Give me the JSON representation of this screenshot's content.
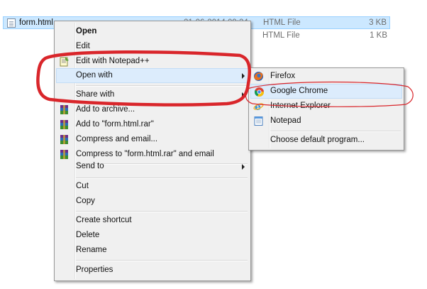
{
  "files": [
    {
      "name": "form.html",
      "date": "21-06-2014 09:24",
      "type": "HTML File",
      "size": "3 KB"
    },
    {
      "name": "",
      "date": "",
      "type": "HTML File",
      "size": "1 KB"
    }
  ],
  "context_menu": {
    "open": "Open",
    "edit": "Edit",
    "edit_notepadpp": "Edit with Notepad++",
    "open_with": "Open with",
    "share_with": "Share with",
    "add_to_archive": "Add to archive...",
    "add_to_rar": "Add to \"form.html.rar\"",
    "compress_email": "Compress and email...",
    "compress_rar_email": "Compress to \"form.html.rar\" and email",
    "send_to": "Send to",
    "cut": "Cut",
    "copy": "Copy",
    "create_shortcut": "Create shortcut",
    "delete": "Delete",
    "rename": "Rename",
    "properties": "Properties"
  },
  "open_with_menu": {
    "firefox": "Firefox",
    "chrome": "Google Chrome",
    "ie": "Internet Explorer",
    "notepad": "Notepad",
    "choose_default": "Choose default program..."
  },
  "colors": {
    "selection": "#cce8ff",
    "menu_highlight": "#dcecfc",
    "annotation_red": "#d9262b"
  }
}
